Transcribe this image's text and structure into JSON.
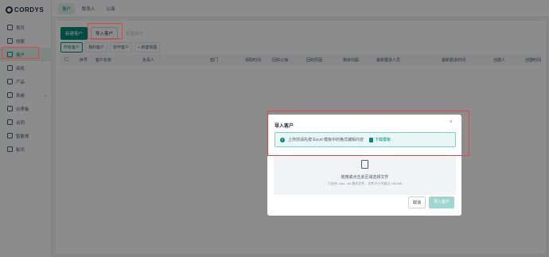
{
  "app": {
    "logo_text": "CORDYS"
  },
  "sidebar": {
    "items": [
      {
        "label": "首页",
        "icon": "home-icon"
      },
      {
        "label": "线索",
        "icon": "clue-icon"
      },
      {
        "label": "客户",
        "icon": "customer-icon",
        "active": true
      },
      {
        "label": "商机",
        "icon": "opportunity-icon"
      },
      {
        "label": "产品",
        "icon": "product-icon"
      },
      {
        "label": "系统",
        "icon": "system-icon",
        "expandable": true
      },
      {
        "label": "仪表板",
        "icon": "dashboard-icon"
      },
      {
        "label": "合同",
        "icon": "contract-icon"
      },
      {
        "label": "智能体",
        "icon": "agent-icon"
      },
      {
        "label": "标讯",
        "icon": "bid-icon"
      }
    ]
  },
  "topbar": {
    "tabs": [
      "客户",
      "联系人",
      "公海"
    ],
    "active": "客户"
  },
  "toolbar": {
    "new_customer": "新建客户",
    "import_customer": "导入客户",
    "disabled_action": "批量操作"
  },
  "views": {
    "tabs": [
      "所有客户",
      "我的客户",
      "协作客户"
    ],
    "add_view": "+ 新建视图"
  },
  "table": {
    "columns": [
      "序号",
      "客户名称",
      "负责人",
      "部门",
      "领取时间",
      "回收公海",
      "回收原因",
      "剩余归属",
      "最新跟进人员",
      "最新跟进时间",
      "创建人",
      "创建时间"
    ]
  },
  "modal": {
    "title": "导入客户",
    "alert_text": "上传前请先按 Excel 模板中的格式编辑内容",
    "download_label": "下载模板",
    "drop_main": "拖拽或点击此区域选择文件",
    "drop_sub": "只支持 .xlsx, .xls 格式文件，文件大小不超过 100 MB",
    "cancel_label": "取消",
    "import_label": "导入客户"
  },
  "colors": {
    "accent": "#00897b",
    "highlight": "#e04545"
  }
}
